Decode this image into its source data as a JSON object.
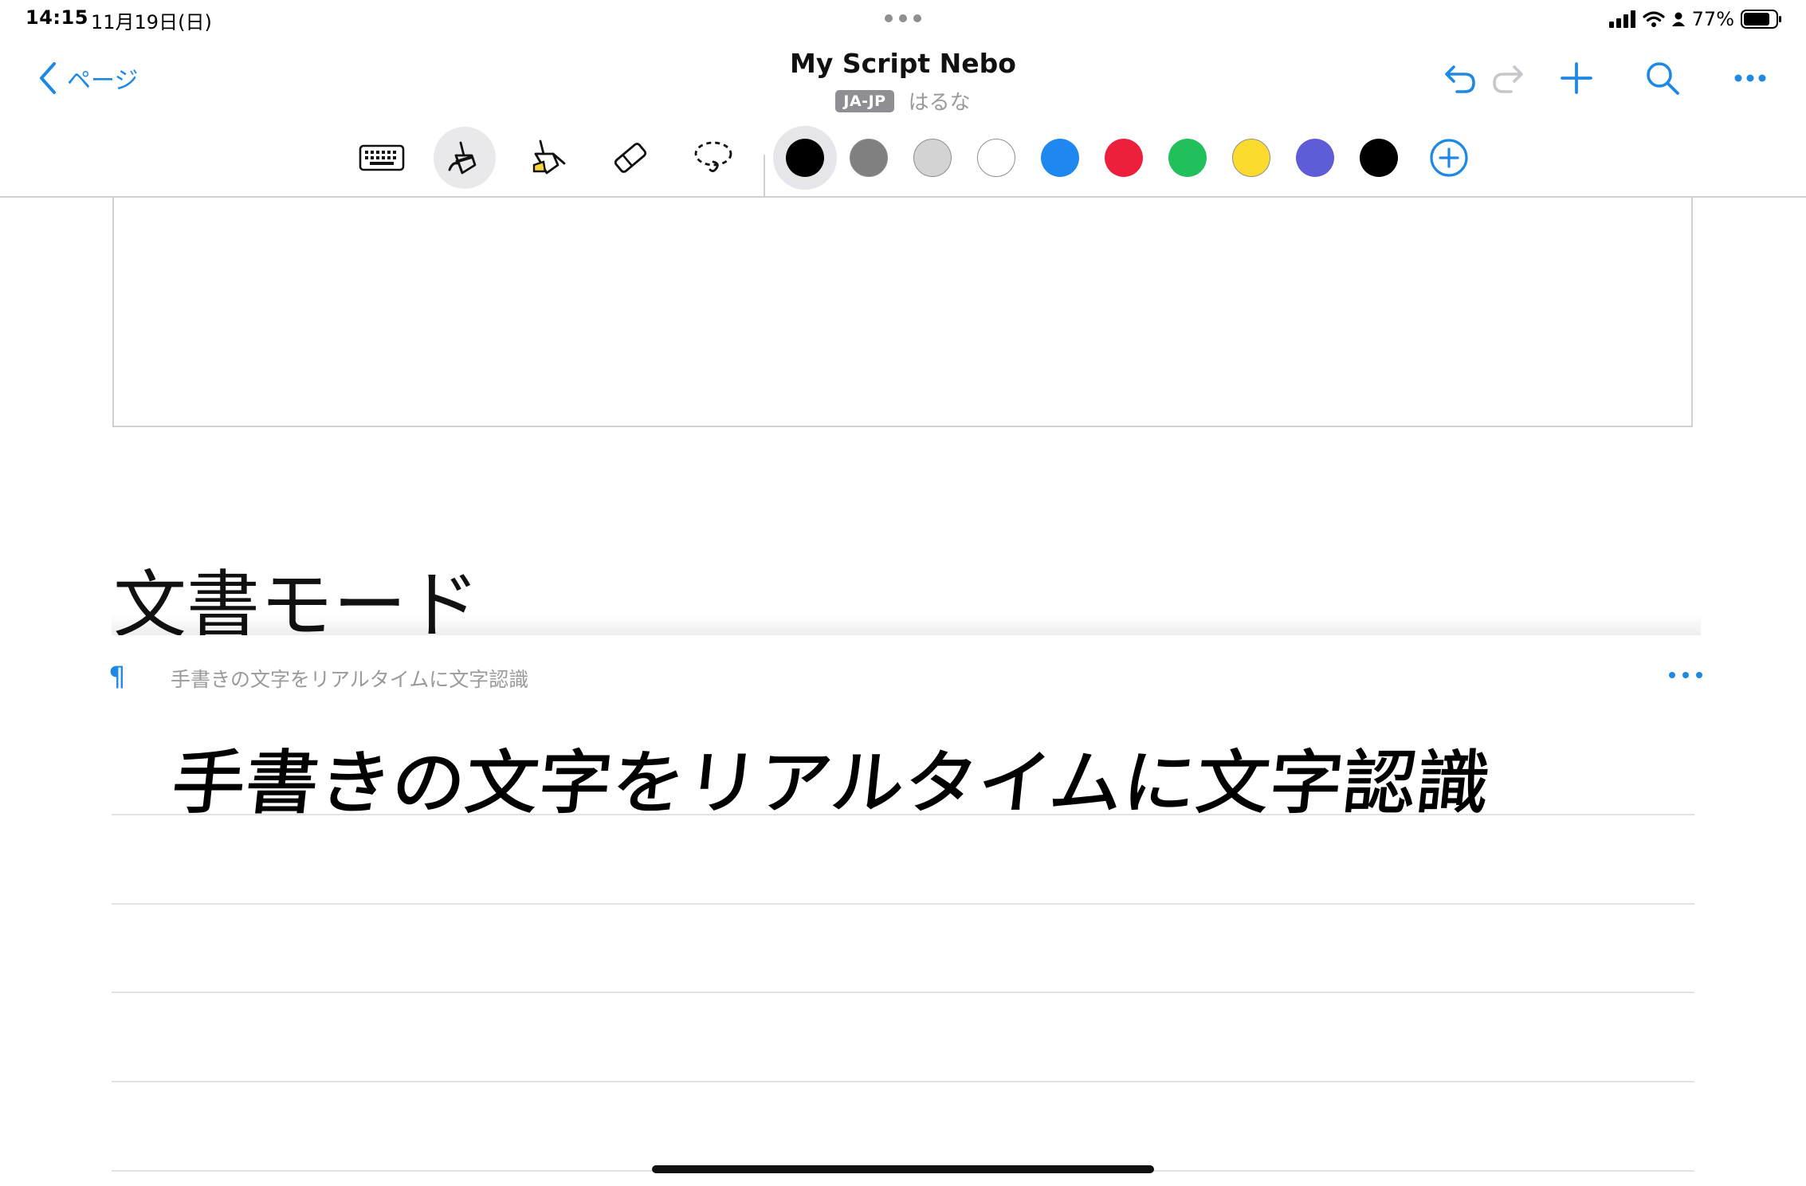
{
  "status_bar": {
    "time": "14:15",
    "date": "11月19日(日)",
    "battery": "77%"
  },
  "nav": {
    "back_label": "ページ",
    "title": "My Script Nebo",
    "language_badge": "JA-JP",
    "font_name": "はるな"
  },
  "toolbar": {
    "tools": [
      "keyboard",
      "pen",
      "highlighter",
      "eraser",
      "lasso"
    ],
    "active_tool": "pen",
    "colors": [
      {
        "name": "black",
        "hex": "#000000",
        "selected": true
      },
      {
        "name": "gray",
        "hex": "#808080"
      },
      {
        "name": "light-gray",
        "hex": "#d3d3d3"
      },
      {
        "name": "white",
        "hex": "#ffffff"
      },
      {
        "name": "blue",
        "hex": "#1e88f0"
      },
      {
        "name": "red",
        "hex": "#ee1f3d"
      },
      {
        "name": "green",
        "hex": "#22c05a"
      },
      {
        "name": "yellow",
        "hex": "#fbdc2e"
      },
      {
        "name": "purple",
        "hex": "#5e5cd6"
      },
      {
        "name": "black-2",
        "hex": "#000000"
      }
    ],
    "accent": "#1e88e5"
  },
  "document": {
    "heading": "文書モード",
    "paragraph_recognized": "手書きの文字をリアルタイムに文字認識",
    "paragraph_handwritten": "手書きの文字をリアルタイムに文字認識"
  }
}
